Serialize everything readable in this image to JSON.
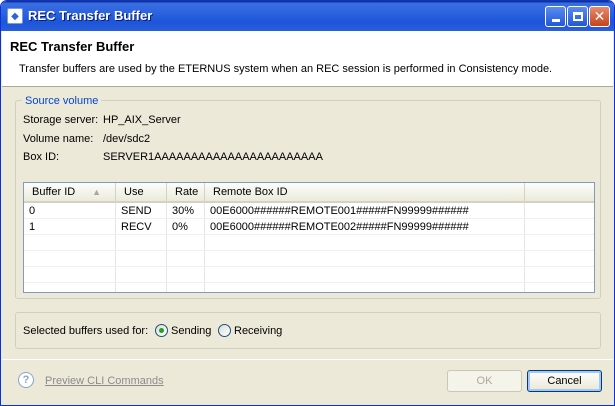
{
  "window": {
    "title": "REC Transfer Buffer"
  },
  "banner": {
    "heading": "REC Transfer Buffer",
    "description": "Transfer buffers are used by the ETERNUS system when an REC session is performed in Consistency mode."
  },
  "source_volume": {
    "legend": "Source volume",
    "storage_server_label": "Storage server:",
    "storage_server_value": "HP_AIX_Server",
    "volume_name_label": "Volume name:",
    "volume_name_value": "/dev/sdc2",
    "box_id_label": "Box ID:",
    "box_id_value": "SERVER1AAAAAAAAAAAAAAAAAAAAAAA"
  },
  "table": {
    "headers": [
      "Buffer ID",
      "Use",
      "Rate",
      "Remote Box ID"
    ],
    "sort_indicator": "▲",
    "rows": [
      {
        "buffer_id": "0",
        "use": "SEND",
        "rate": "30%",
        "remote_box_id": "00E6000######REMOTE001#####FN99999######"
      },
      {
        "buffer_id": "1",
        "use": "RECV",
        "rate": "0%",
        "remote_box_id": "00E6000######REMOTE002#####FN99999######"
      }
    ]
  },
  "selection": {
    "label": "Selected buffers used for:",
    "options": [
      {
        "label": "Sending",
        "checked": true
      },
      {
        "label": "Receiving",
        "checked": false
      }
    ]
  },
  "footer": {
    "help_icon": "question-mark-icon",
    "cli_link": "Preview CLI Commands",
    "ok_label": "OK",
    "cancel_label": "Cancel"
  },
  "colors": {
    "title_bar": "#2b63de",
    "legend": "#0046d5",
    "radio_selected": "#21a121"
  }
}
